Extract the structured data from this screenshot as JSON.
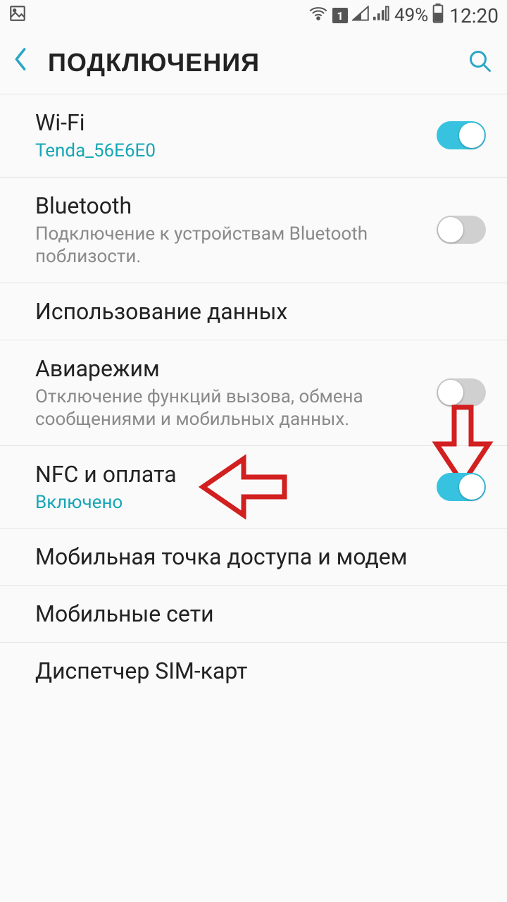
{
  "status": {
    "battery_pct": "49%",
    "time": "12:20",
    "sim_label": "1"
  },
  "header": {
    "title": "ПОДКЛЮЧЕНИЯ"
  },
  "rows": {
    "wifi": {
      "title": "Wi-Fi",
      "sub": "Tenda_56E6E0",
      "on": true
    },
    "bt": {
      "title": "Bluetooth",
      "sub": "Подключение к устройствам Bluetooth поблизости.",
      "on": false
    },
    "data": {
      "title": "Использование данных"
    },
    "air": {
      "title": "Авиарежим",
      "sub": "Отключение функций вызова, обмена сообщениями и мобильных данных.",
      "on": false
    },
    "nfc": {
      "title": "NFC и оплата",
      "sub": "Включено",
      "on": true
    },
    "hotspot": {
      "title": "Мобильная точка доступа и модем"
    },
    "mobile": {
      "title": "Мобильные сети"
    },
    "sim": {
      "title": "Диспетчер SIM-карт"
    }
  },
  "colors": {
    "accent": "#2aa6c7",
    "toggle_on": "#37c3e0",
    "arrow": "#d21f1f"
  }
}
